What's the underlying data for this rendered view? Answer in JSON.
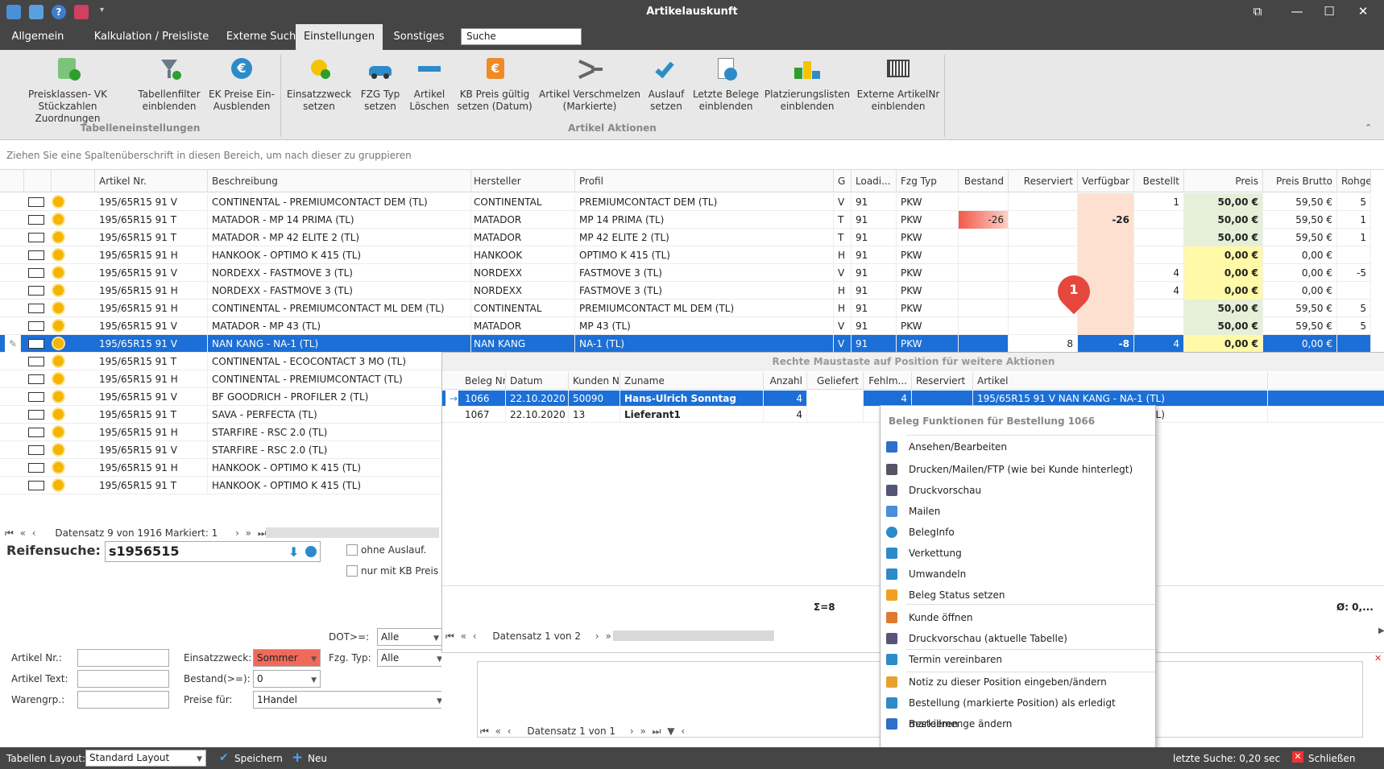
{
  "window": {
    "title": "Artikelauskunft",
    "controls": {
      "restore": "⧉",
      "minimize": "—",
      "maximize": "☐",
      "close": "✕"
    }
  },
  "tabs": [
    "Allgemein",
    "Kalkulation / Preisliste",
    "Externe Suche",
    "Einstellungen",
    "Sonstiges"
  ],
  "search": {
    "placeholder": "Suche"
  },
  "ribbon": {
    "buttons": [
      "Preisklassen- VK\nStückzahlen Zuordnungen",
      "Tabellenfilter\neinblenden",
      "EK Preise Ein-\nAusblenden",
      "Einsatzzweck\nsetzen",
      "FZG Typ\nsetzen",
      "Artikel\nLöschen",
      "KB Preis gültig\nsetzen (Datum)",
      "Artikel Verschmelzen\n(Markierte)",
      "Auslauf\nsetzen",
      "Letzte Belege\neinblenden",
      "Platzierungslisten\neinblenden",
      "Externe ArtikelNr\neinblenden"
    ],
    "groups": [
      "Tabelleneinstellungen",
      "Artikel Aktionen"
    ]
  },
  "groupbar": "Ziehen Sie eine Spaltenüberschrift in diesen Bereich, um nach dieser zu gruppieren",
  "grid": {
    "headers": [
      "Artikel Nr.",
      "Beschreibung",
      "Hersteller",
      "Profil",
      "G",
      "Loadi...",
      "Fzg Typ",
      "Bestand",
      "Reserviert",
      "Verfügbar",
      "Bestellt",
      "Preis",
      "Preis Brutto",
      "Rohgev"
    ],
    "rows": [
      [
        "195/65R15 91 V",
        "CONTINENTAL - PREMIUMCONTACT DEM (TL)",
        "CONTINENTAL",
        "PREMIUMCONTACT DEM (TL)",
        "V",
        "91",
        "PKW",
        "",
        "",
        "",
        "1",
        "50,00 €",
        "59,50 €",
        "5"
      ],
      [
        "195/65R15 91 T",
        "MATADOR - MP 14 PRIMA (TL)",
        "MATADOR",
        "MP 14 PRIMA (TL)",
        "T",
        "91",
        "PKW",
        "-26",
        "",
        "-26",
        "",
        "50,00 €",
        "59,50 €",
        "1"
      ],
      [
        "195/65R15 91 T",
        "MATADOR - MP 42 ELITE 2 (TL)",
        "MATADOR",
        "MP 42 ELITE 2 (TL)",
        "T",
        "91",
        "PKW",
        "",
        "",
        "",
        "",
        "50,00 €",
        "59,50 €",
        "1"
      ],
      [
        "195/65R15 91 H",
        "HANKOOK - OPTIMO K 415 (TL)",
        "HANKOOK",
        "OPTIMO K 415 (TL)",
        "H",
        "91",
        "PKW",
        "",
        "",
        "",
        "",
        "0,00 €",
        "0,00 €",
        ""
      ],
      [
        "195/65R15 91 V",
        "NORDEXX - FASTMOVE 3 (TL)",
        "NORDEXX",
        "FASTMOVE 3 (TL)",
        "V",
        "91",
        "PKW",
        "",
        "",
        "",
        "4",
        "0,00 €",
        "0,00 €",
        "-5"
      ],
      [
        "195/65R15 91 H",
        "NORDEXX - FASTMOVE 3 (TL)",
        "NORDEXX",
        "FASTMOVE 3 (TL)",
        "H",
        "91",
        "PKW",
        "",
        "",
        "",
        "4",
        "0,00 €",
        "0,00 €",
        ""
      ],
      [
        "195/65R15 91 H",
        "CONTINENTAL - PREMIUMCONTACT ML DEM (TL)",
        "CONTINENTAL",
        "PREMIUMCONTACT ML DEM (TL)",
        "H",
        "91",
        "PKW",
        "",
        "",
        "",
        "",
        "50,00 €",
        "59,50 €",
        "5"
      ],
      [
        "195/65R15 91 V",
        "MATADOR - MP 43 (TL)",
        "MATADOR",
        "MP 43 (TL)",
        "V",
        "91",
        "PKW",
        "",
        "",
        "",
        "",
        "50,00 €",
        "59,50 €",
        "5"
      ],
      [
        "195/65R15 91 V",
        "NAN KANG - NA-1 (TL)",
        "NAN KANG",
        "NA-1 (TL)",
        "V",
        "91",
        "PKW",
        "",
        "8",
        "-8",
        "4",
        "0,00 €",
        "0,00 €",
        ""
      ],
      [
        "195/65R15 91 T",
        "CONTINENTAL - ECOCONTACT 3 MO (TL)"
      ],
      [
        "195/65R15 91 H",
        "CONTINENTAL - PREMIUMCONTACT (TL)"
      ],
      [
        "195/65R15 91 V",
        "BF GOODRICH - PROFILER 2 (TL)"
      ],
      [
        "195/65R15 91 T",
        "SAVA - PERFECTA (TL)"
      ],
      [
        "195/65R15 91 H",
        "STARFIRE - RSC 2.0 (TL)"
      ],
      [
        "195/65R15 91 V",
        "STARFIRE - RSC 2.0 (TL)"
      ],
      [
        "195/65R15 91 H",
        "HANKOOK - OPTIMO K 415 (TL)"
      ],
      [
        "195/65R15 91 T",
        "HANKOOK - OPTIMO K 415 (TL)"
      ]
    ],
    "nav": "Datensatz 9 von 1916 Markiert: 1"
  },
  "marker": "1",
  "posPanel": {
    "title": "Rechte Maustaste auf Position für weitere Aktionen",
    "headers": [
      "Beleg Nr",
      "Datum",
      "Kunden Nr.",
      "Zuname",
      "Anzahl",
      "Geliefert",
      "Fehlm...",
      "Reserviert",
      "Artikel"
    ],
    "rows": [
      [
        "1066",
        "22.10.2020",
        "50090",
        "Hans-Ulrich Sonntag",
        "4",
        "",
        "4",
        "",
        "195/65R15 91 V NAN KANG - NA-1 (TL)"
      ],
      [
        "1067",
        "22.10.2020",
        "13",
        "Lieferant1",
        "4",
        "",
        "",
        "",
        "195/65R15 91 V NAN KANG - NA-1 (TL)"
      ]
    ],
    "sum": "Σ=8",
    "avg": "Ø: 0,...",
    "nav": "Datensatz 1 von 2",
    "nav2": "Datensatz 1 von 1"
  },
  "contextMenu": {
    "title": "Beleg Funktionen für Bestellung 1066",
    "items": [
      "Ansehen/Bearbeiten",
      "Drucken/Mailen/FTP (wie bei Kunde hinterlegt)",
      "Druckvorschau",
      "Mailen",
      "BelegInfo",
      "Verkettung",
      "Umwandeln",
      "Beleg Status setzen",
      "Kunde öffnen",
      "Druckvorschau (aktuelle Tabelle)",
      "Termin vereinbaren",
      "Notiz zu dieser Position eingeben/ändern",
      "Bestellung (markierte Position) als erledigt markieren",
      "Bestellmenge ändern"
    ]
  },
  "left": {
    "reifensuche_label": "Reifensuche:",
    "reifensuche_value": "s1956515",
    "ohne_auslauf": "ohne Auslauf.",
    "nur_kb": "nur mit KB Preis",
    "dot_label": "DOT>=:",
    "dot_value": "Alle",
    "artikelnr": "Artikel Nr.:",
    "artikeltext": "Artikel Text:",
    "warengrp": "Warengrp.:",
    "einsatz_label": "Einsatzzweck:",
    "einsatz_value": "Sommer",
    "fzg_label": "Fzg. Typ:",
    "fzg_value": "Alle",
    "bestand_label": "Bestand(>=):",
    "bestand_value": "0",
    "preise_label": "Preise für:",
    "preise_value": "1Handel"
  },
  "status": {
    "layout_label": "Tabellen Layout:",
    "layout_value": "Standard Layout",
    "save": "Speichern",
    "new": "Neu",
    "last_search": "letzte Suche: 0,20 sec",
    "close": "Schließen"
  }
}
